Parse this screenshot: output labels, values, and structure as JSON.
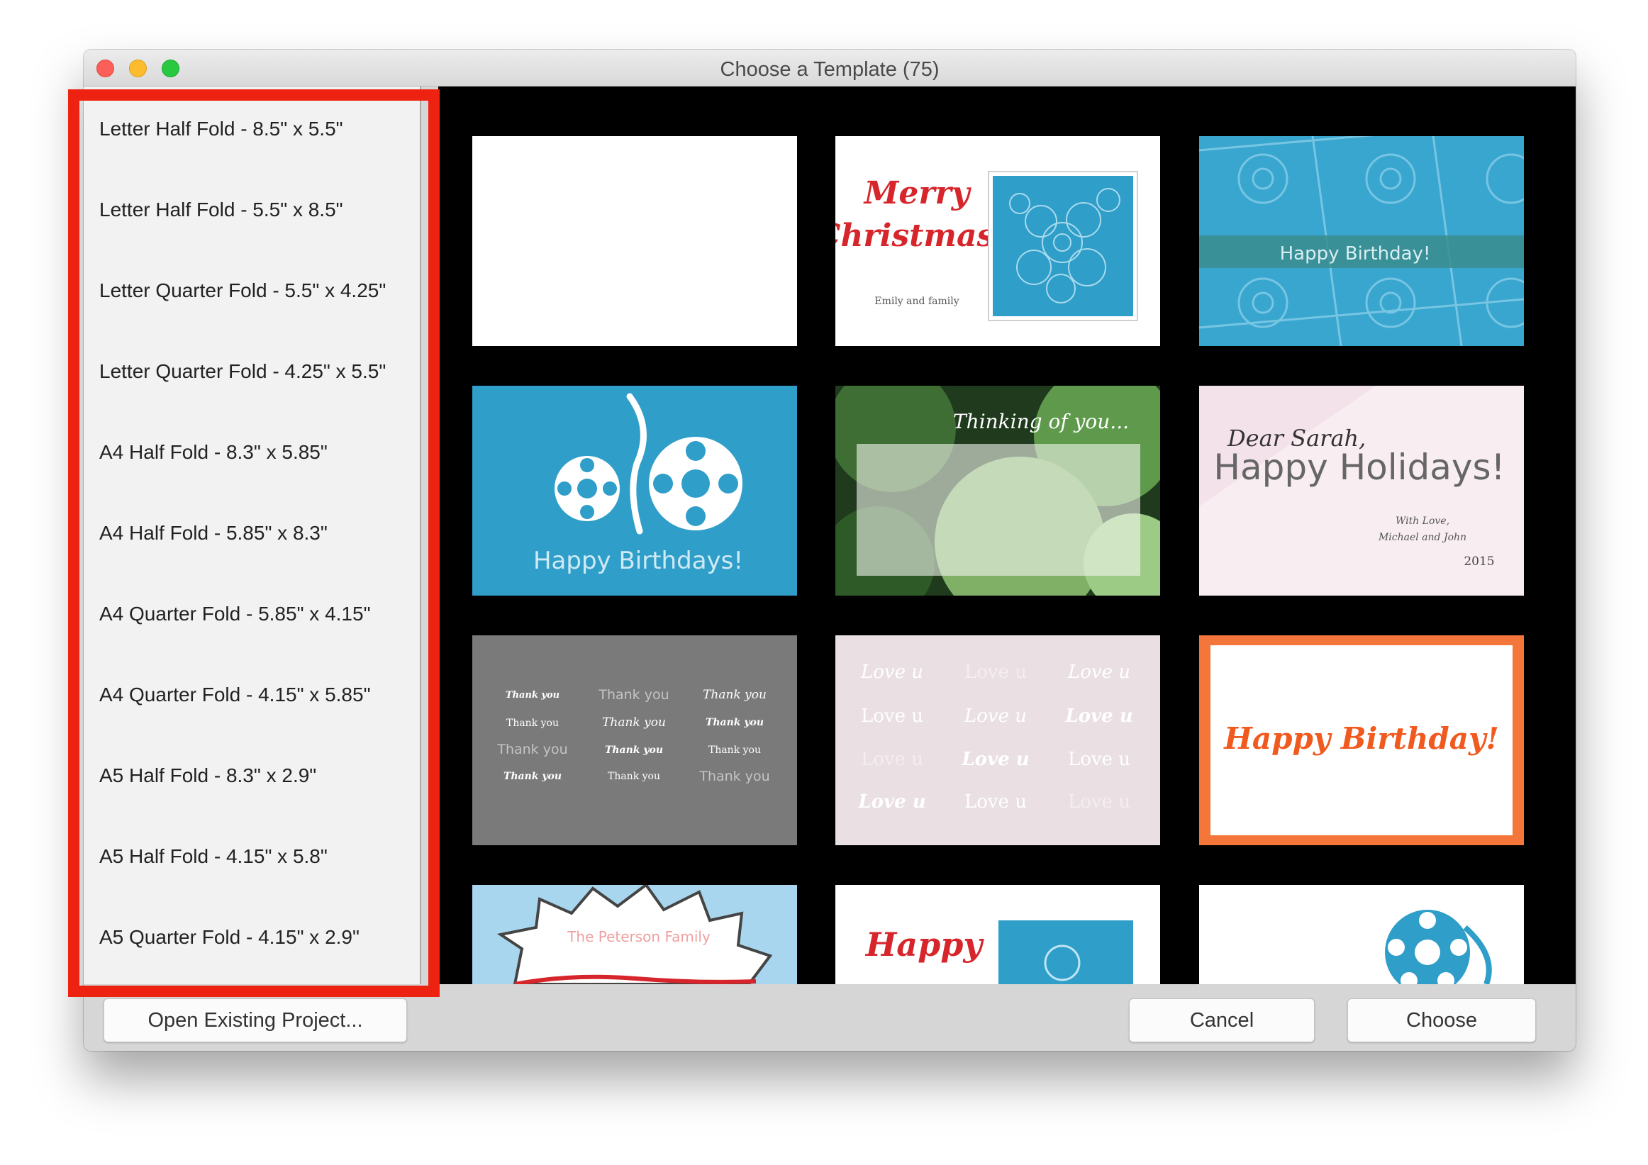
{
  "window": {
    "title": "Choose a Template (75)"
  },
  "sidebar": {
    "items": [
      {
        "label": "Letter Half Fold - 8.5\" x 5.5\""
      },
      {
        "label": "Letter Half Fold - 5.5\" x 8.5\""
      },
      {
        "label": "Letter Quarter Fold - 5.5\" x 4.25\""
      },
      {
        "label": "Letter Quarter Fold - 4.25\" x 5.5\""
      },
      {
        "label": "A4 Half Fold - 8.3\" x 5.85\""
      },
      {
        "label": "A4 Half Fold - 5.85\" x 8.3\""
      },
      {
        "label": "A4 Quarter Fold - 5.85\" x 4.15\""
      },
      {
        "label": "A4 Quarter Fold - 4.15\" x 5.85\""
      },
      {
        "label": "A5 Half Fold - 8.3\" x 2.9\""
      },
      {
        "label": "A5 Half Fold - 4.15\" x 5.8\""
      },
      {
        "label": "A5 Quarter Fold - 4.15\" x 2.9\""
      }
    ]
  },
  "templates": {
    "christmas": {
      "line1": "Merry",
      "line2": "Christmas!",
      "signature": "Emily and family"
    },
    "birthday_banner": {
      "text": "Happy Birthday!"
    },
    "birthdays_blue": {
      "text": "Happy Birthdays!"
    },
    "thinking": {
      "text": "Thinking of you..."
    },
    "holidays": {
      "greeting": "Dear Sarah,",
      "title": "Happy Holidays!",
      "sign1": "With Love,",
      "sign2": "Michael and John",
      "year": "2015"
    },
    "thank_you": {
      "words": [
        "Thank you",
        "Thank you",
        "Thank you",
        "Thank you",
        "Thank you",
        "Thank you",
        "Thank you",
        "Thank you",
        "Thank you",
        "Thank you",
        "Thank you",
        "Thank you"
      ]
    },
    "love_u": {
      "words": [
        "Love u",
        "Love u",
        "Love u",
        "Love u",
        "Love u",
        "Love u",
        "Love u",
        "Love u",
        "Love u",
        "Love u",
        "Love u",
        "Love u"
      ]
    },
    "birthday_orange": {
      "text": "Happy Birthday!"
    },
    "peterson": {
      "family": "The Peterson Family"
    },
    "happy_partial": {
      "text": "Happy"
    }
  },
  "footer": {
    "open_label": "Open Existing Project...",
    "cancel_label": "Cancel",
    "choose_label": "Choose"
  },
  "colors": {
    "highlight": "#ee2211",
    "card_blue": "#2f9ec9",
    "card_orange": "#f5763a",
    "christmas_red": "#d7262b"
  }
}
